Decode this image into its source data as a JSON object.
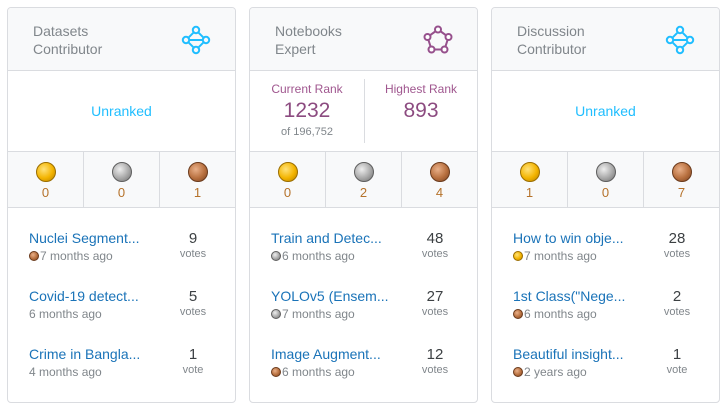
{
  "cards": [
    {
      "tier_line1": "Datasets",
      "tier_line2": "Contributor",
      "tier_icon": "contributor-icon",
      "tier_color": "#20beff",
      "rank": {
        "unranked": "Unranked"
      },
      "medals": {
        "gold": "0",
        "silver": "0",
        "bronze": "1"
      },
      "items": [
        {
          "title": "Nuclei Segment...",
          "medal": "bronze",
          "age": "7 months ago",
          "votes": "9",
          "vote_label": "votes"
        },
        {
          "title": "Covid-19 detect...",
          "medal": "",
          "age": "6 months ago",
          "votes": "5",
          "vote_label": "votes"
        },
        {
          "title": "Crime in Bangla...",
          "medal": "",
          "age": "4 months ago",
          "votes": "1",
          "vote_label": "vote"
        }
      ]
    },
    {
      "tier_line1": "Notebooks",
      "tier_line2": "Expert",
      "tier_icon": "expert-icon",
      "tier_color": "#96508c",
      "rank": {
        "current_label": "Current Rank",
        "current_value": "1232",
        "current_sub": "of 196,752",
        "highest_label": "Highest Rank",
        "highest_value": "893"
      },
      "medals": {
        "gold": "0",
        "silver": "2",
        "bronze": "4"
      },
      "items": [
        {
          "title": "Train and Detec...",
          "medal": "silver",
          "age": "6 months ago",
          "votes": "48",
          "vote_label": "votes"
        },
        {
          "title": "YOLOv5 (Ensem...",
          "medal": "silver",
          "age": "7 months ago",
          "votes": "27",
          "vote_label": "votes"
        },
        {
          "title": "Image Augment...",
          "medal": "bronze",
          "age": "6 months ago",
          "votes": "12",
          "vote_label": "votes"
        }
      ]
    },
    {
      "tier_line1": "Discussion",
      "tier_line2": "Contributor",
      "tier_icon": "contributor-icon",
      "tier_color": "#20beff",
      "rank": {
        "unranked": "Unranked"
      },
      "medals": {
        "gold": "1",
        "silver": "0",
        "bronze": "7"
      },
      "items": [
        {
          "title": "How to win obje...",
          "medal": "gold",
          "age": "7 months ago",
          "votes": "28",
          "vote_label": "votes"
        },
        {
          "title": "1st Class(\"Nege...",
          "medal": "bronze",
          "age": "6 months ago",
          "votes": "2",
          "vote_label": "votes"
        },
        {
          "title": "Beautiful insight...",
          "medal": "bronze",
          "age": "2 years ago",
          "votes": "1",
          "vote_label": "vote"
        }
      ]
    }
  ]
}
